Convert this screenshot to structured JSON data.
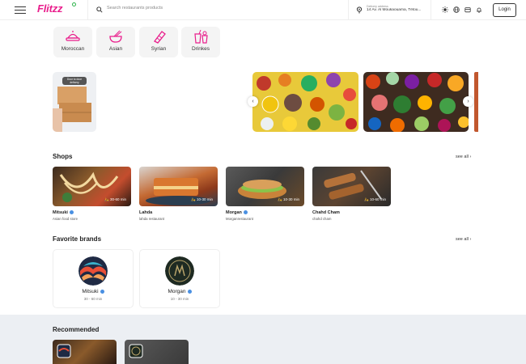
{
  "header": {
    "logo": "Flitzz",
    "search_placeholder": "Search restaurants products",
    "delivery_label": "Delivery address",
    "delivery_address": "14 Av. Al Moukaouama, Tétou...",
    "login_label": "Login"
  },
  "categories": [
    {
      "label": "Moroccan",
      "icon": "tagine-icon"
    },
    {
      "label": "Asian",
      "icon": "noodle-bowl-icon"
    },
    {
      "label": "Syrian",
      "icon": "wrap-icon"
    },
    {
      "label": "Drinkes",
      "icon": "drinks-icon"
    }
  ],
  "banner_promo": {
    "text": "Door to door delivery"
  },
  "shops_section": {
    "title": "Shops",
    "see_all": "see all",
    "items": [
      {
        "name": "Mitsuki",
        "subtitle": "Asian food store",
        "time": "30-60 min",
        "verified": true
      },
      {
        "name": "Lahda",
        "subtitle": "lahda restaurant",
        "time": "10-30 min",
        "verified": false
      },
      {
        "name": "Morgan",
        "subtitle": "Morganrestaurant",
        "time": "10-30 min",
        "verified": true
      },
      {
        "name": "Chahd Cham",
        "subtitle": "chahd cham",
        "time": "10-60 min",
        "verified": false
      }
    ]
  },
  "brands_section": {
    "title": "Favorite brands",
    "see_all": "see all",
    "items": [
      {
        "name": "Mitsuki",
        "time": "30 - 60 min",
        "verified": true
      },
      {
        "name": "Morgan",
        "time": "10 - 30 min",
        "verified": true
      }
    ]
  },
  "recommended_section": {
    "title": "Recommended"
  },
  "colors": {
    "brand": "#e91e8c",
    "accent_green": "#2db34a",
    "verified": "#4a90e2"
  }
}
